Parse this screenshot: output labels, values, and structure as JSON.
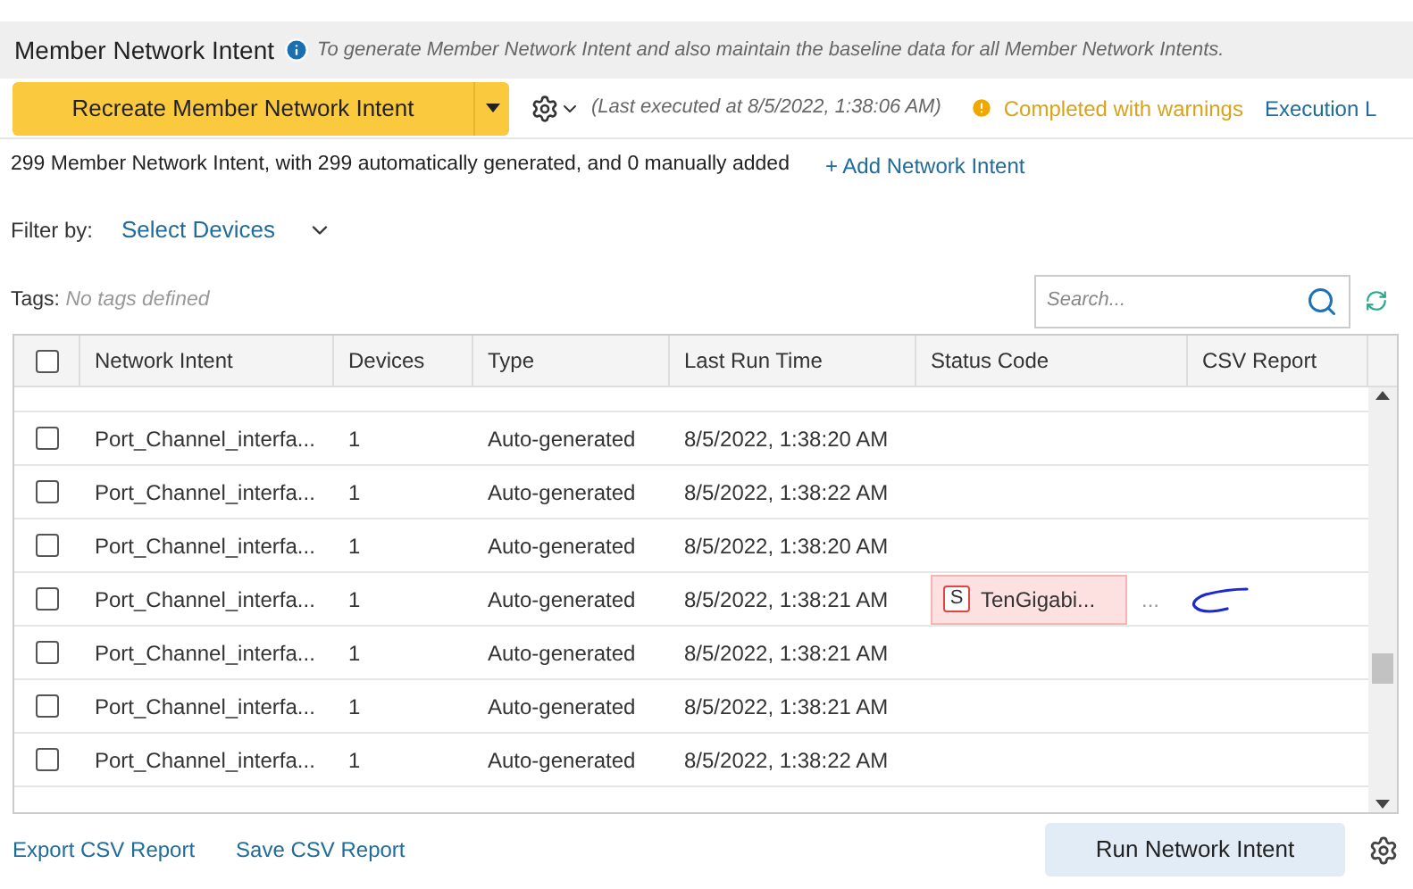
{
  "header": {
    "title": "Member Network Intent",
    "description": "To generate Member Network Intent and also maintain the baseline data for all Member Network Intents."
  },
  "toolbar": {
    "primary_button": "Recreate Member Network Intent",
    "last_executed": "(Last executed at 8/5/2022, 1:38:06 AM)",
    "status": "Completed with warnings",
    "log_link": "Execution L"
  },
  "summary": {
    "text": "299 Member Network Intent, with 299 automatically generated, and 0 manually added",
    "add_link": "+ Add Network Intent"
  },
  "filter": {
    "label": "Filter by:",
    "value": "Select Devices"
  },
  "tags": {
    "label": "Tags:",
    "value": "No tags defined"
  },
  "search": {
    "placeholder": "Search..."
  },
  "table": {
    "select_all_checked": false,
    "columns": [
      "Network Intent",
      "Devices",
      "Type",
      "Last Run Time",
      "Status Code",
      "CSV Report"
    ],
    "rows": [
      {
        "checked": false,
        "name": "Port_Channel_interfa...",
        "devices": "1",
        "type": "Auto-generated",
        "last_run": "8/5/2022, 1:38:20 AM"
      },
      {
        "checked": false,
        "name": "Port_Channel_interfa...",
        "devices": "1",
        "type": "Auto-generated",
        "last_run": "8/5/2022, 1:38:22 AM"
      },
      {
        "checked": false,
        "name": "Port_Channel_interfa...",
        "devices": "1",
        "type": "Auto-generated",
        "last_run": "8/5/2022, 1:38:20 AM"
      },
      {
        "checked": false,
        "name": "Port_Channel_interfa...",
        "devices": "1",
        "type": "Auto-generated",
        "last_run": "8/5/2022, 1:38:21 AM",
        "status": {
          "badge": "S",
          "text": "TenGigabi...",
          "more": "..."
        }
      },
      {
        "checked": false,
        "name": "Port_Channel_interfa...",
        "devices": "1",
        "type": "Auto-generated",
        "last_run": "8/5/2022, 1:38:21 AM"
      },
      {
        "checked": false,
        "name": "Port_Channel_interfa...",
        "devices": "1",
        "type": "Auto-generated",
        "last_run": "8/5/2022, 1:38:21 AM"
      },
      {
        "checked": false,
        "name": "Port_Channel_interfa...",
        "devices": "1",
        "type": "Auto-generated",
        "last_run": "8/5/2022, 1:38:22 AM"
      }
    ]
  },
  "footer": {
    "links": [
      "Export CSV Report",
      "Save CSV Report"
    ],
    "run_button": "Run Network Intent"
  }
}
